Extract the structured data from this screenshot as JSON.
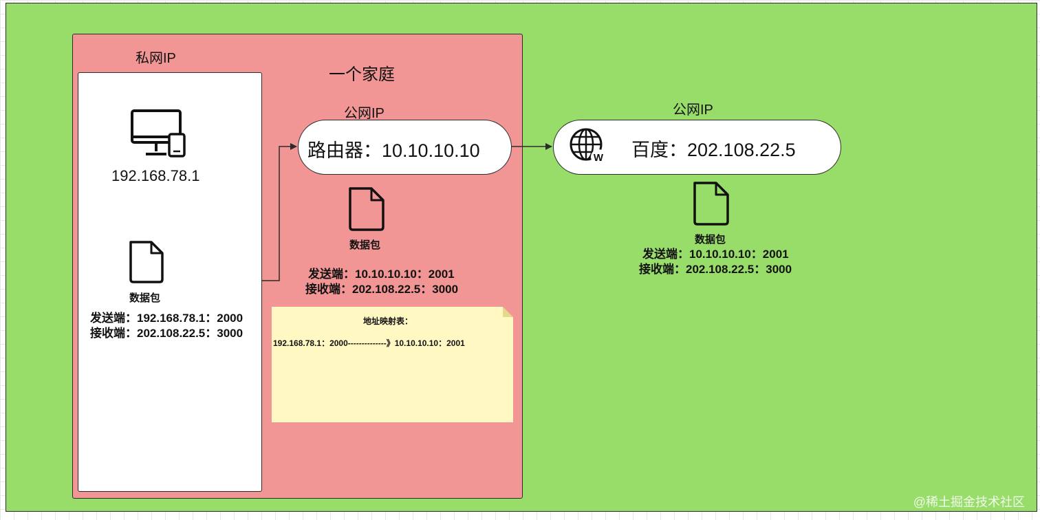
{
  "family_label": "一个家庭",
  "private_ip_label": "私网IP",
  "router_public_label": "公网IP",
  "server_public_label": "公网IP",
  "computer": {
    "icon": "computer-monitor-phone-icon",
    "ip": "192.168.78.1"
  },
  "router": {
    "label": "路由器：10.10.10.10"
  },
  "server": {
    "icon": "globe-web-icon",
    "label": "百度：202.108.22.5"
  },
  "packet_private": {
    "icon": "document-icon",
    "label": "数据包",
    "sender": "发送端：192.168.78.1：2000",
    "receiver": "接收端：202.108.22.5：3000"
  },
  "packet_router": {
    "icon": "document-icon",
    "label": "数据包",
    "sender": "发送端：10.10.10.10：2001",
    "receiver": "接收端：202.108.22.5：3000"
  },
  "packet_server": {
    "icon": "document-icon",
    "label": "数据包",
    "sender": "发送端：10.10.10.10：2001",
    "receiver": "接收端：202.108.22.5：3000"
  },
  "nat_table": {
    "title": "地址映射表：",
    "row": "192.168.78.1：2000--------------》10.10.10.10：2001"
  },
  "watermark": "@稀土掘金技术社区",
  "colors": {
    "outer_background": "#98dd6a",
    "family_box": "#f19694",
    "note": "#fff8c2"
  }
}
